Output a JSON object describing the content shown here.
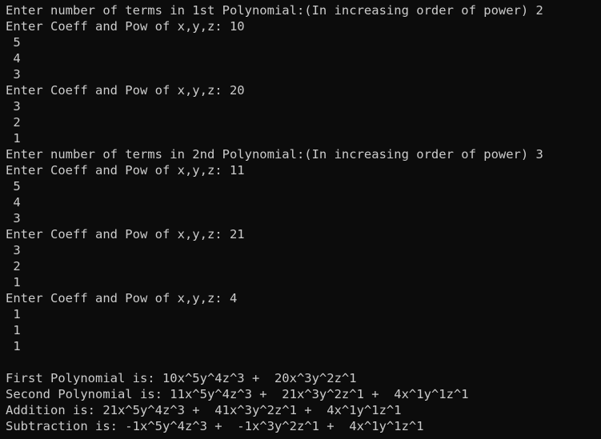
{
  "terminal": {
    "lines": [
      "Enter number of terms in 1st Polynomial:(In increasing order of power) 2",
      "Enter Coeff and Pow of x,y,z: 10",
      " 5",
      " 4",
      " 3",
      "Enter Coeff and Pow of x,y,z: 20",
      " 3",
      " 2",
      " 1",
      "Enter number of terms in 2nd Polynomial:(In increasing order of power) 3",
      "Enter Coeff and Pow of x,y,z: 11",
      " 5",
      " 4",
      " 3",
      "Enter Coeff and Pow of x,y,z: 21",
      " 3",
      " 2",
      " 1",
      "Enter Coeff and Pow of x,y,z: 4",
      " 1",
      " 1",
      " 1",
      "",
      "First Polynomial is: 10x^5y^4z^3 +  20x^3y^2z^1",
      "Second Polynomial is: 11x^5y^4z^3 +  21x^3y^2z^1 +  4x^1y^1z^1",
      "Addition is: 21x^5y^4z^3 +  41x^3y^2z^1 +  4x^1y^1z^1",
      "Subtraction is: -1x^5y^4z^3 +  -1x^3y^2z^1 +  4x^1y^1z^1"
    ]
  },
  "colors": {
    "background": "#0c0c0c",
    "text": "#cccccc",
    "clipped_text": "#e74856"
  }
}
